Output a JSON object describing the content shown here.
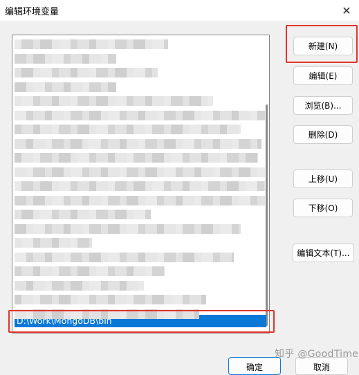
{
  "window": {
    "title": "编辑环境变量",
    "close_glyph": "✕"
  },
  "path_list": {
    "selected_value": "D:\\Work\\MongoDB\\bin",
    "blurred_rows": 20
  },
  "buttons": {
    "new": "新建(N)",
    "edit": "编辑(E)",
    "browse": "浏览(B)...",
    "delete": "删除(D)",
    "move_up": "上移(U)",
    "move_down": "下移(O)",
    "edit_text": "编辑文本(T)...",
    "ok": "确定",
    "cancel": "取消"
  },
  "watermark": "知乎 @GoodTime",
  "colors": {
    "selection": "#0a78d7",
    "highlight": "#e5332a",
    "blur_light": "#eaeaea",
    "blur_dark": "#d4d4d4"
  },
  "icons": {
    "close": "close-icon"
  }
}
